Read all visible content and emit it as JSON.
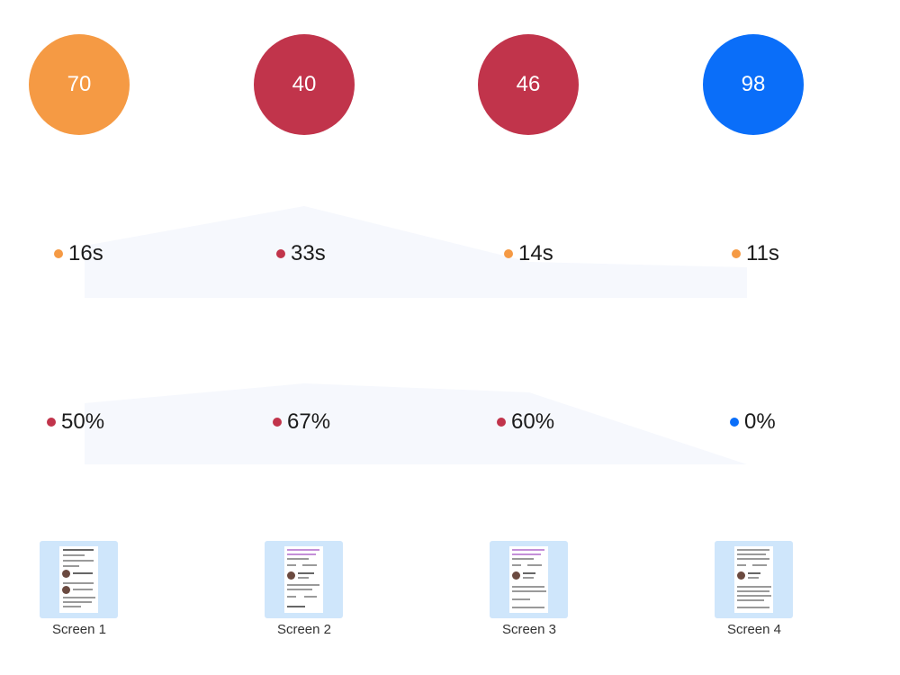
{
  "colors": {
    "orange": "#f59a44",
    "red": "#c1344b",
    "blue": "#0a6ef9",
    "band": "#f6f8fd",
    "screen_bg": "#cfe6fb"
  },
  "scores": [
    {
      "value": "70",
      "color": "#f59a44"
    },
    {
      "value": "40",
      "color": "#c1344b"
    },
    {
      "value": "46",
      "color": "#c1344b"
    },
    {
      "value": "98",
      "color": "#0a6ef9"
    }
  ],
  "times": [
    {
      "text": "16s",
      "color": "#f59a44"
    },
    {
      "text": "33s",
      "color": "#c1344b"
    },
    {
      "text": "14s",
      "color": "#f59a44"
    },
    {
      "text": "11s",
      "color": "#f59a44"
    }
  ],
  "percents": [
    {
      "text": "50%",
      "color": "#c1344b"
    },
    {
      "text": "67%",
      "color": "#c1344b"
    },
    {
      "text": "60%",
      "color": "#c1344b"
    },
    {
      "text": "0%",
      "color": "#0a6ef9"
    }
  ],
  "screens": [
    {
      "label": "Screen 1"
    },
    {
      "label": "Screen 2"
    },
    {
      "label": "Screen 3"
    },
    {
      "label": "Screen 4"
    }
  ]
}
